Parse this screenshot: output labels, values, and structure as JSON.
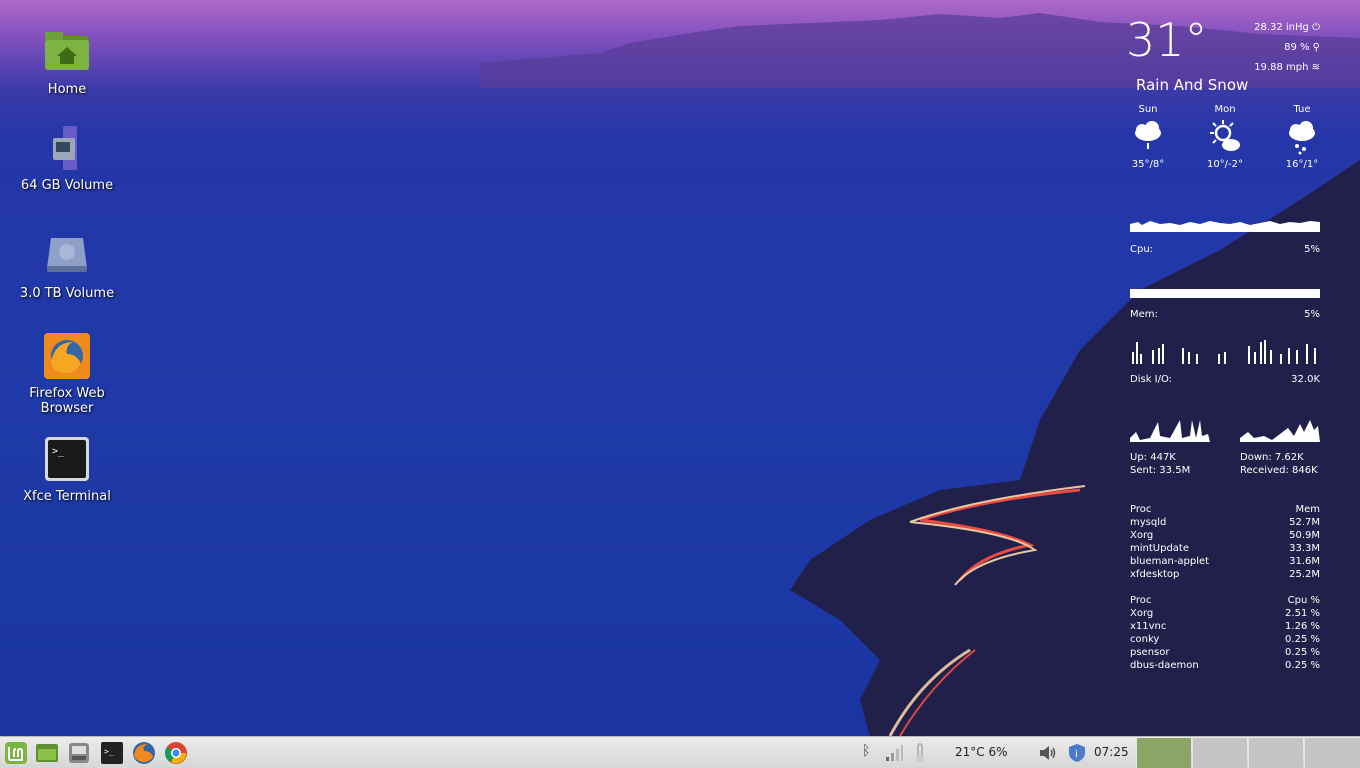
{
  "desktop": {
    "icons": [
      {
        "label": "Home"
      },
      {
        "label": "64 GB Volume"
      },
      {
        "label": "3.0 TB Volume"
      },
      {
        "label": "Firefox Web Browser"
      },
      {
        "label": "Xfce Terminal"
      }
    ]
  },
  "weather": {
    "temperature": "31°",
    "pressure": "28.32 inHg",
    "humidity": "89 %",
    "wind": "19.88 mph",
    "condition": "Rain And Snow",
    "forecast": [
      {
        "day": "Sun",
        "range": "35°/8°",
        "icon": "rain-cloud-icon"
      },
      {
        "day": "Mon",
        "range": "10°/-2°",
        "icon": "sun-cloud-icon"
      },
      {
        "day": "Tue",
        "range": "16°/1°",
        "icon": "snow-cloud-icon"
      }
    ]
  },
  "system": {
    "cpu_label": "Cpu:",
    "cpu_value": "5%",
    "mem_label": "Mem:",
    "mem_value": "5%",
    "disk_label": "Disk I/O:",
    "disk_value": "32.0K",
    "up": "Up: 447K",
    "down": "Down: 7.62K",
    "sent": "Sent: 33.5M",
    "received": "Received: 846K",
    "mem_table": {
      "header_proc": "Proc",
      "header_val": "Mem",
      "rows": [
        {
          "proc": "mysqld",
          "val": "52.7M"
        },
        {
          "proc": "Xorg",
          "val": "50.9M"
        },
        {
          "proc": "mintUpdate",
          "val": "33.3M"
        },
        {
          "proc": "blueman-applet",
          "val": "31.6M"
        },
        {
          "proc": "xfdesktop",
          "val": "25.2M"
        }
      ]
    },
    "cpu_table": {
      "header_proc": "Proc",
      "header_val": "Cpu %",
      "rows": [
        {
          "proc": "Xorg",
          "val": "2.51 %"
        },
        {
          "proc": "x11vnc",
          "val": "1.26 %"
        },
        {
          "proc": "conky",
          "val": "0.25 %"
        },
        {
          "proc": "psensor",
          "val": "0.25 %"
        },
        {
          "proc": "dbus-daemon",
          "val": "0.25 %"
        }
      ]
    }
  },
  "taskbar": {
    "sensor": "21°C 6%",
    "clock": "07:25",
    "launchers": [
      "mint-menu-icon",
      "file-manager-icon",
      "drive-icon",
      "terminal-icon",
      "firefox-icon",
      "chrome-icon"
    ],
    "workspaces": 4,
    "active_workspace": 1
  },
  "colors": {
    "taskbar_bg": "#dcdcdc",
    "workspace_active": "#8aa566",
    "mint_green": "#6aa84f"
  }
}
